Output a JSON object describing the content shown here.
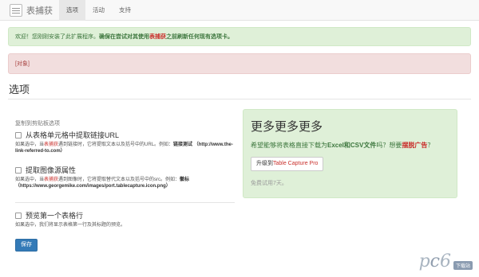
{
  "app": {
    "name": "表捕获",
    "logo_icon": "table-capture-logo-icon"
  },
  "nav": {
    "tabs": [
      {
        "label": "选项",
        "active": true
      },
      {
        "label": "活动",
        "active": false
      },
      {
        "label": "支持",
        "active": false
      }
    ]
  },
  "alerts": {
    "success": {
      "prefix": "欢迎！您刚刚安装了此扩展程序。",
      "bold_a": "确保在尝试对其使用",
      "emph": "表捕获",
      "bold_b": "之前刷新任何现有选项卡。"
    },
    "error": {
      "text": "[对象]"
    }
  },
  "page": {
    "title": "选项"
  },
  "options": {
    "heading": "复制到剪贴板选项",
    "items": [
      {
        "label": "从表格单元格中提取链接URL",
        "checked": false,
        "help_a": "如果选中，当",
        "help_emph": "表捕获",
        "help_b": "遇到链接时，它将提取文本以及括号中的URL。例如：",
        "help_bold": "链接测试 （http://www.the-link-referred-to.com）"
      },
      {
        "label": "提取图像源属性",
        "checked": false,
        "help_a": "如果选中，当",
        "help_emph": "表捕获",
        "help_b": "遇到图像时，它将提取替代文本以及括号中的src。例如：",
        "help_bold": "徽标 （https://www.georgemike.com/images/port.tablecapture.icon.png）"
      },
      {
        "label": "预览第一个表格行",
        "checked": false,
        "help_a": "如果选中，我们将显示表格第一行及其标题的预览。",
        "help_emph": "",
        "help_b": "",
        "help_bold": ""
      }
    ],
    "save_label": "保存"
  },
  "promo": {
    "title": "更多更多更多",
    "text_a": "希望能够将表格直接下载为",
    "text_bold": "Excel和CSV文件",
    "text_b": "吗？想要",
    "text_link": "摆脱广告",
    "text_c": "？",
    "upgrade_prefix": "升级到",
    "upgrade_emph": "Table Capture Pro",
    "trial_text": "免费试用7天。"
  },
  "watermark": {
    "main_a": "p",
    "main_o": "c",
    "main_b": "6",
    "sub": "下载站"
  },
  "colors": {
    "primary": "#337ab7",
    "success_bg": "#dff0d8",
    "danger_bg": "#f2dede",
    "accent_red": "#c9302c"
  }
}
